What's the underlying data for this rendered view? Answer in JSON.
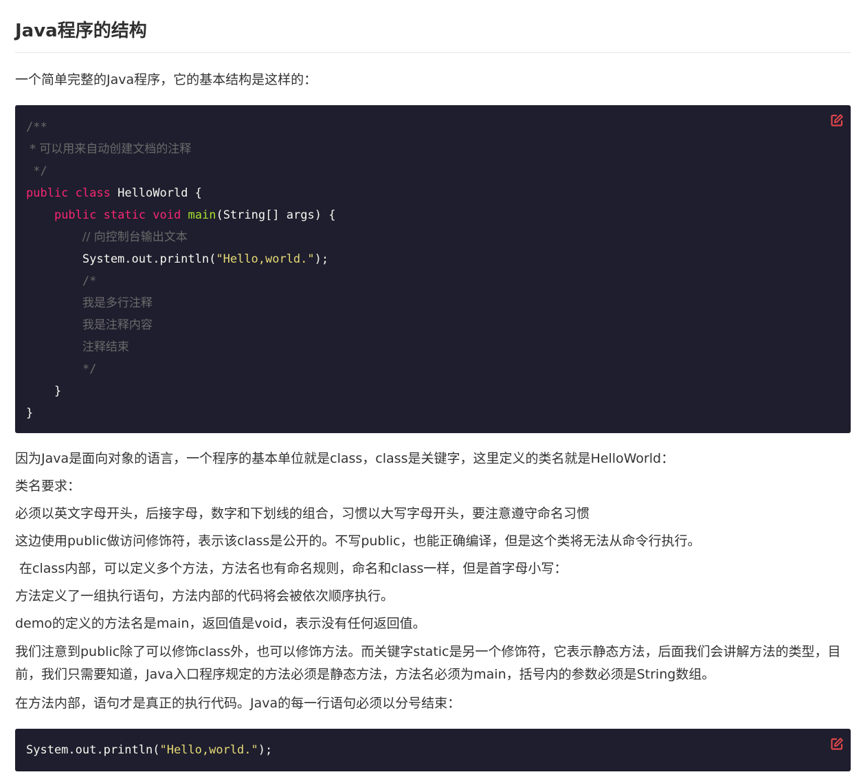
{
  "heading": "Java程序的结构",
  "intro": "一个简单完整的Java程序，它的基本结构是这样的：",
  "code_block_1": {
    "lines": [
      [
        {
          "t": "comment",
          "v": "/**"
        }
      ],
      [
        {
          "t": "comment",
          "v": " * 可以用来自动创建文档的注释"
        }
      ],
      [
        {
          "t": "comment",
          "v": " */"
        }
      ],
      [
        {
          "t": "keyword",
          "v": "public"
        },
        {
          "t": "plain",
          "v": " "
        },
        {
          "t": "keyword",
          "v": "class"
        },
        {
          "t": "plain",
          "v": " HelloWorld {"
        }
      ],
      [
        {
          "t": "plain",
          "v": "    "
        },
        {
          "t": "keyword",
          "v": "public"
        },
        {
          "t": "plain",
          "v": " "
        },
        {
          "t": "keyword",
          "v": "static"
        },
        {
          "t": "plain",
          "v": " "
        },
        {
          "t": "keyword",
          "v": "void"
        },
        {
          "t": "plain",
          "v": " "
        },
        {
          "t": "func",
          "v": "main"
        },
        {
          "t": "plain",
          "v": "(String[] args) {"
        }
      ],
      [
        {
          "t": "plain",
          "v": "        "
        },
        {
          "t": "comment",
          "v": "// 向控制台输出文本"
        }
      ],
      [
        {
          "t": "plain",
          "v": "        System.out.println("
        },
        {
          "t": "string",
          "v": "\"Hello,world.\""
        },
        {
          "t": "plain",
          "v": ");"
        }
      ],
      [
        {
          "t": "plain",
          "v": "        "
        },
        {
          "t": "comment",
          "v": "/*"
        }
      ],
      [
        {
          "t": "plain",
          "v": "        "
        },
        {
          "t": "comment",
          "v": "我是多行注释"
        }
      ],
      [
        {
          "t": "plain",
          "v": "        "
        },
        {
          "t": "comment",
          "v": "我是注释内容"
        }
      ],
      [
        {
          "t": "plain",
          "v": "        "
        },
        {
          "t": "comment",
          "v": "注释结束"
        }
      ],
      [
        {
          "t": "plain",
          "v": "        "
        },
        {
          "t": "comment",
          "v": "*/"
        }
      ],
      [
        {
          "t": "plain",
          "v": "    }"
        }
      ],
      [
        {
          "t": "plain",
          "v": "}"
        }
      ]
    ]
  },
  "paragraphs": [
    "因为Java是面向对象的语言，一个程序的基本单位就是class，class是关键字，这里定义的类名就是HelloWorld：",
    "类名要求：",
    "必须以英文字母开头，后接字母，数字和下划线的组合，习惯以大写字母开头，要注意遵守命名习惯",
    "这边使用public做访问修饰符，表示该class是公开的。不写public，也能正确编译，但是这个类将无法从命令行执行。",
    " 在class内部，可以定义多个方法，方法名也有命名规则，命名和class一样，但是首字母小写：",
    "方法定义了一组执行语句，方法内部的代码将会被依次顺序执行。",
    "demo的定义的方法名是main，返回值是void，表示没有任何返回值。",
    "我们注意到public除了可以修饰class外，也可以修饰方法。而关键字static是另一个修饰符，它表示静态方法，后面我们会讲解方法的类型，目前，我们只需要知道，Java入口程序规定的方法必须是静态方法，方法名必须为main，括号内的参数必须是String数组。",
    "在方法内部，语句才是真正的执行代码。Java的每一行语句必须以分号结束："
  ],
  "code_block_2": {
    "lines": [
      [
        {
          "t": "plain",
          "v": "System.out.println("
        },
        {
          "t": "string",
          "v": "\"Hello,world.\""
        },
        {
          "t": "plain",
          "v": ");"
        }
      ]
    ]
  },
  "icons": {
    "edit": "edit-icon"
  },
  "colors": {
    "code_bg": "#1f1e2e",
    "keyword": "#f92672",
    "function": "#a6e22e",
    "string": "#e6db74",
    "comment": "#6a6a6a",
    "edit_icon": "#e0464b"
  }
}
